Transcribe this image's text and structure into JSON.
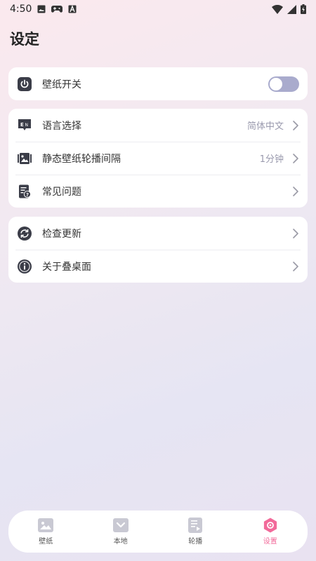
{
  "status_bar": {
    "time": "4:50",
    "icons": [
      "image-icon",
      "gamepad-icon",
      "font-icon",
      "wifi-icon",
      "signal-icon",
      "battery-charging-icon"
    ]
  },
  "page": {
    "title": "设定"
  },
  "card1": {
    "rows": [
      {
        "label": "壁纸开关",
        "icon": "power-icon",
        "control": "toggle",
        "toggle_on": false
      }
    ]
  },
  "card2": {
    "rows": [
      {
        "label": "语言选择",
        "value": "简体中文",
        "icon": "language-en-icon"
      },
      {
        "label": "静态壁纸轮播间隔",
        "value": "1分钟",
        "icon": "image-frame-icon"
      },
      {
        "label": "常见问题",
        "icon": "faq-icon"
      }
    ]
  },
  "card3": {
    "rows": [
      {
        "label": "检查更新",
        "icon": "refresh-icon"
      },
      {
        "label": "关于叠桌面",
        "icon": "info-icon"
      }
    ]
  },
  "tabbar": {
    "tabs": [
      {
        "label": "壁纸",
        "icon": "wallpaper-icon",
        "active": false
      },
      {
        "label": "本地",
        "icon": "local-icon",
        "active": false
      },
      {
        "label": "轮播",
        "icon": "carousel-icon",
        "active": false
      },
      {
        "label": "设置",
        "icon": "settings-icon",
        "active": true
      }
    ]
  },
  "colors": {
    "accent": "#f26a9a",
    "toggle_off_track": "#a9abcd",
    "icon_dark": "#3b3d48",
    "value_text": "#9a9aae",
    "tab_inactive_icon": "#c9c9d3"
  }
}
